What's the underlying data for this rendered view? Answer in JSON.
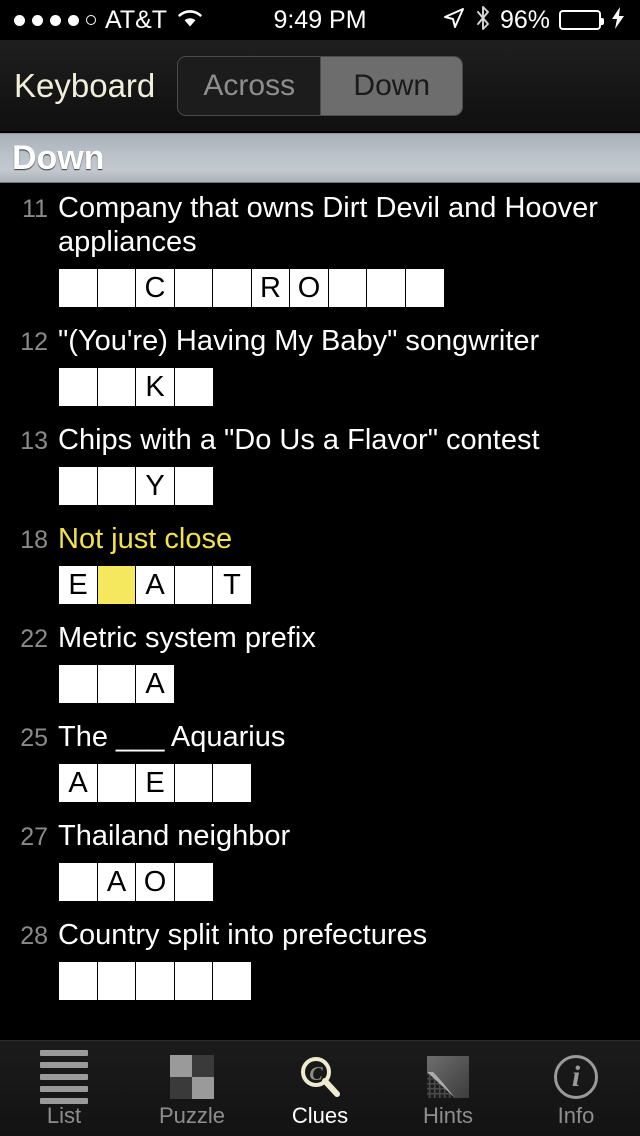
{
  "statusbar": {
    "signal_dots_total": 5,
    "signal_dots_filled": 4,
    "carrier": "AT&T",
    "wifi_icon": "wifi-icon",
    "time": "9:49 PM",
    "location_icon": "location-arrow-icon",
    "bluetooth_icon": "bluetooth-icon",
    "battery_percent": "96%",
    "battery_fill": 96,
    "battery_color": "#4CD964",
    "charging_icon": "lightning-bolt-icon"
  },
  "navbar": {
    "back_label": "Keyboard",
    "segments": [
      {
        "label": "Across",
        "selected": false
      },
      {
        "label": "Down",
        "selected": true
      }
    ]
  },
  "section": {
    "title": "Down"
  },
  "colors": {
    "accent_cream": "#F1EFDC",
    "active_clue_yellow": "#F2E24B",
    "selected_cell_yellow": "#F5E85E",
    "clue_number_gray": "#8A8A8A",
    "background": "#000000"
  },
  "clues": [
    {
      "number": "11",
      "text": "Company that owns Dirt Devil and Hoover appliances",
      "active": false,
      "cells": [
        {
          "letter": "",
          "selected": false
        },
        {
          "letter": "",
          "selected": false
        },
        {
          "letter": "C",
          "selected": false
        },
        {
          "letter": "",
          "selected": false
        },
        {
          "letter": "",
          "selected": false
        },
        {
          "letter": "R",
          "selected": false
        },
        {
          "letter": "O",
          "selected": false
        },
        {
          "letter": "",
          "selected": false
        },
        {
          "letter": "",
          "selected": false
        },
        {
          "letter": "",
          "selected": false
        }
      ]
    },
    {
      "number": "12",
      "text": "\"(You're) Having My Baby\" songwriter",
      "active": false,
      "cells": [
        {
          "letter": "",
          "selected": false
        },
        {
          "letter": "",
          "selected": false
        },
        {
          "letter": "K",
          "selected": false
        },
        {
          "letter": "",
          "selected": false
        }
      ]
    },
    {
      "number": "13",
      "text": "Chips with a \"Do Us a Flavor\" contest",
      "active": false,
      "cells": [
        {
          "letter": "",
          "selected": false
        },
        {
          "letter": "",
          "selected": false
        },
        {
          "letter": "Y",
          "selected": false
        },
        {
          "letter": "",
          "selected": false
        }
      ]
    },
    {
      "number": "18",
      "text": "Not just close",
      "active": true,
      "cells": [
        {
          "letter": "E",
          "selected": false
        },
        {
          "letter": "",
          "selected": true
        },
        {
          "letter": "A",
          "selected": false
        },
        {
          "letter": "",
          "selected": false
        },
        {
          "letter": "T",
          "selected": false
        }
      ]
    },
    {
      "number": "22",
      "text": "Metric system prefix",
      "active": false,
      "cells": [
        {
          "letter": "",
          "selected": false
        },
        {
          "letter": "",
          "selected": false
        },
        {
          "letter": "A",
          "selected": false
        }
      ]
    },
    {
      "number": "25",
      "text": "The ___ Aquarius",
      "active": false,
      "cells": [
        {
          "letter": "A",
          "selected": false
        },
        {
          "letter": "",
          "selected": false
        },
        {
          "letter": "E",
          "selected": false
        },
        {
          "letter": "",
          "selected": false
        },
        {
          "letter": "",
          "selected": false
        }
      ]
    },
    {
      "number": "27",
      "text": "Thailand neighbor",
      "active": false,
      "cells": [
        {
          "letter": "",
          "selected": false
        },
        {
          "letter": "A",
          "selected": false
        },
        {
          "letter": "O",
          "selected": false
        },
        {
          "letter": "",
          "selected": false
        }
      ]
    },
    {
      "number": "28",
      "text": "Country split into prefectures",
      "active": false,
      "cells": [
        {
          "letter": "",
          "selected": false
        },
        {
          "letter": "",
          "selected": false
        },
        {
          "letter": "",
          "selected": false
        },
        {
          "letter": "",
          "selected": false
        },
        {
          "letter": "",
          "selected": false
        }
      ]
    }
  ],
  "tabbar": {
    "items": [
      {
        "label": "List",
        "icon": "list-lines-icon",
        "active": false
      },
      {
        "label": "Puzzle",
        "icon": "checkerboard-grid-icon",
        "active": false
      },
      {
        "label": "Clues",
        "icon": "magnifier-c-icon",
        "active": true
      },
      {
        "label": "Hints",
        "icon": "peeling-corner-icon",
        "active": false
      },
      {
        "label": "Info",
        "icon": "info-circle-icon",
        "active": false
      }
    ]
  }
}
